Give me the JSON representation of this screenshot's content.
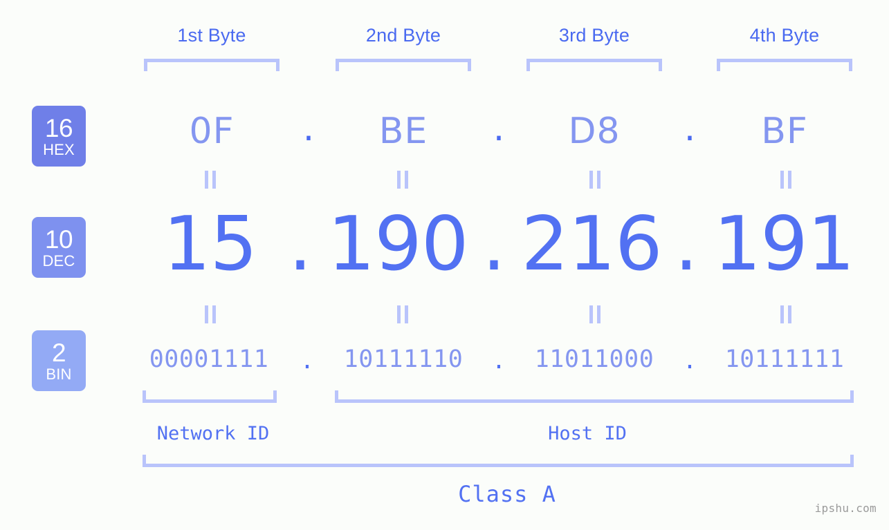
{
  "ip": {
    "dotted_decimal": "15.190.216.191",
    "class": "Class A"
  },
  "byte_headers": [
    {
      "label": "1st Byte"
    },
    {
      "label": "2nd Byte"
    },
    {
      "label": "3rd Byte"
    },
    {
      "label": "4th Byte"
    }
  ],
  "bases": [
    {
      "num": "16",
      "name": "HEX",
      "color": "#6f7fe8"
    },
    {
      "num": "10",
      "name": "DEC",
      "color": "#7e91ef"
    },
    {
      "num": "2",
      "name": "BIN",
      "color": "#93aaf5"
    }
  ],
  "rows": {
    "hex": {
      "values": [
        "0F",
        "BE",
        "D8",
        "BF"
      ],
      "separator": "."
    },
    "dec": {
      "values": [
        "15",
        "190",
        "216",
        "191"
      ],
      "separator": "."
    },
    "bin": {
      "values": [
        "00001111",
        "10111110",
        "11011000",
        "10111111"
      ],
      "separator": "."
    }
  },
  "segments": [
    {
      "label": "Network ID"
    },
    {
      "label": "Host ID"
    }
  ],
  "class_label": "Class A",
  "watermark": "ipshu.com",
  "colors": {
    "background": "#fbfdfa",
    "header_text": "#4a6af0",
    "bracket": "#b9c4fb",
    "hex_text": "#8496f0",
    "dec_text": "#5271f2",
    "bin_text": "#8496f0",
    "watermark": "#9a9a9a"
  }
}
